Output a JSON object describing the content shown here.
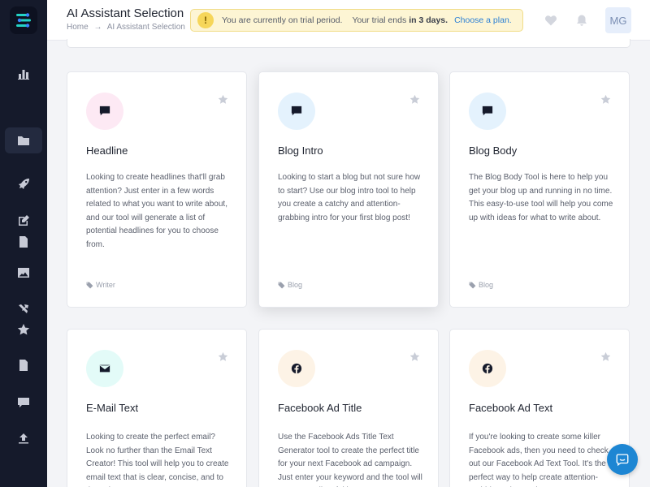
{
  "header": {
    "title": "AI Assistant Selection",
    "breadcrumb": [
      "Home",
      "→",
      "AI Assistant Selection"
    ],
    "trial": {
      "message": "You are currently on trial period.",
      "ends_prefix": "Your trial ends",
      "ends_value": "in 3 days.",
      "link": "Choose a plan."
    },
    "avatar_initials": "MG"
  },
  "sidebar": {
    "icons": [
      "bar-chart-icon",
      "folder-icon",
      "rocket-icon",
      "edit-icon",
      "document-icon",
      "image-icon",
      "tools-icon",
      "star-icon",
      "document-icon",
      "chat-icon",
      "upload-icon"
    ]
  },
  "cards": [
    {
      "title": "Headline",
      "description": "Looking to create headlines that'll grab attention? Just enter in a few words related to what you want to write about, and our tool will generate a list of potential headlines for you to choose from.",
      "tag": "Writer",
      "icon": "message-icon",
      "color": "#fde9f4"
    },
    {
      "title": "Blog Intro",
      "description": "Looking to start a blog but not sure how to start? Use our blog intro tool to help you create a catchy and attention-grabbing intro for your first blog post!",
      "tag": "Blog",
      "icon": "message-icon",
      "color": "#e4f2fd"
    },
    {
      "title": "Blog Body",
      "description": "The Blog Body Tool is here to help you get your blog up and running in no time. This easy-to-use tool will help you come up with ideas for what to write about.",
      "tag": "Blog",
      "icon": "message-icon",
      "color": "#e4f2fd"
    },
    {
      "title": "E-Mail Text",
      "description": "Looking to create the perfect email? Look no further than the Email Text Creator! This tool will help you to create email text that is clear, concise, and to the point.",
      "tag": "",
      "icon": "envelope-icon",
      "color": "#e3fbf8"
    },
    {
      "title": "Facebook Ad Title",
      "description": "Use the Facebook Ads Title Text Generator tool to create the perfect title for your next Facebook ad campaign. Just enter your keyword and the tool will generate a list of titles.",
      "tag": "",
      "icon": "facebook-icon",
      "color": "#fdf3e6"
    },
    {
      "title": "Facebook Ad Text",
      "description": "If you're looking to create some killer Facebook ads, then you need to check out our Facebook Ad Text Tool. It's the perfect way to help create attention-grabbing ad copy that converts.",
      "tag": "",
      "icon": "facebook-icon",
      "color": "#fdf3e6"
    }
  ]
}
